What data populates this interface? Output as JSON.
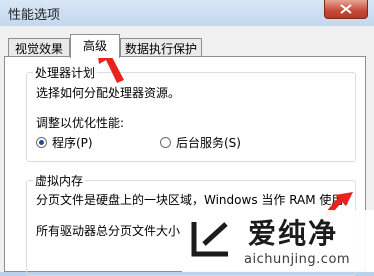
{
  "window": {
    "title": "性能选项"
  },
  "tabs": [
    {
      "label": "视觉效果"
    },
    {
      "label": "高级"
    },
    {
      "label": "数据执行保护"
    }
  ],
  "processor": {
    "group_title": "处理器计划",
    "description": "选择如何分配处理器资源。",
    "adjust_label": "调整以优化性能:",
    "option_programs": "程序(P)",
    "option_services": "后台服务(S)"
  },
  "virtual_memory": {
    "group_title": "虚拟内存",
    "line1": "分页文件是硬盘上的一块区域，Windows 当作 RAM 使用。",
    "line2": "所有驱动器总分页文件大小"
  },
  "watermark": {
    "brand": "爱纯净",
    "url": "aichunjing.com",
    "logo_icon": "corner-bracket-logo-icon"
  },
  "annotation": {
    "arrow_color": "#e8221c"
  }
}
